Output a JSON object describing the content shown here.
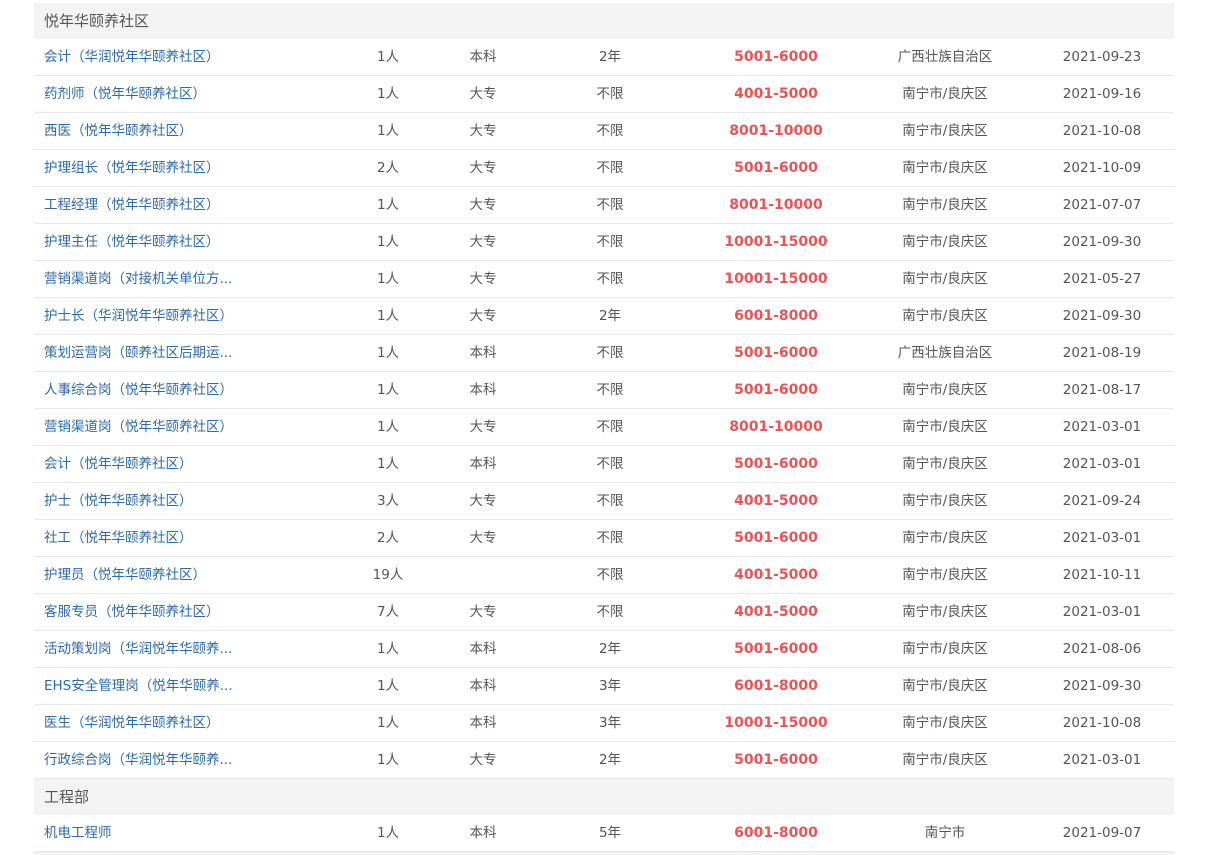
{
  "sections": [
    {
      "title": "悦年华颐养社区",
      "rows": [
        {
          "title": "会计（华润悦年华颐养社区）",
          "num": "1人",
          "edu": "本科",
          "exp": "2年",
          "salary": "5001-6000",
          "location": "广西壮族自治区",
          "date": "2021-09-23"
        },
        {
          "title": "药剂师（悦年华颐养社区）",
          "num": "1人",
          "edu": "大专",
          "exp": "不限",
          "salary": "4001-5000",
          "location": "南宁市/良庆区",
          "date": "2021-09-16"
        },
        {
          "title": "西医（悦年华颐养社区）",
          "num": "1人",
          "edu": "大专",
          "exp": "不限",
          "salary": "8001-10000",
          "location": "南宁市/良庆区",
          "date": "2021-10-08"
        },
        {
          "title": "护理组长（悦年华颐养社区）",
          "num": "2人",
          "edu": "大专",
          "exp": "不限",
          "salary": "5001-6000",
          "location": "南宁市/良庆区",
          "date": "2021-10-09"
        },
        {
          "title": "工程经理（悦年华颐养社区）",
          "num": "1人",
          "edu": "大专",
          "exp": "不限",
          "salary": "8001-10000",
          "location": "南宁市/良庆区",
          "date": "2021-07-07"
        },
        {
          "title": "护理主任（悦年华颐养社区）",
          "num": "1人",
          "edu": "大专",
          "exp": "不限",
          "salary": "10001-15000",
          "location": "南宁市/良庆区",
          "date": "2021-09-30"
        },
        {
          "title": "营销渠道岗（对接机关单位方...",
          "num": "1人",
          "edu": "大专",
          "exp": "不限",
          "salary": "10001-15000",
          "location": "南宁市/良庆区",
          "date": "2021-05-27"
        },
        {
          "title": "护士长（华润悦年华颐养社区）",
          "num": "1人",
          "edu": "大专",
          "exp": "2年",
          "salary": "6001-8000",
          "location": "南宁市/良庆区",
          "date": "2021-09-30"
        },
        {
          "title": "策划运营岗（颐养社区后期运...",
          "num": "1人",
          "edu": "本科",
          "exp": "不限",
          "salary": "5001-6000",
          "location": "广西壮族自治区",
          "date": "2021-08-19"
        },
        {
          "title": "人事综合岗（悦年华颐养社区）",
          "num": "1人",
          "edu": "本科",
          "exp": "不限",
          "salary": "5001-6000",
          "location": "南宁市/良庆区",
          "date": "2021-08-17"
        },
        {
          "title": "营销渠道岗（悦年华颐养社区）",
          "num": "1人",
          "edu": "大专",
          "exp": "不限",
          "salary": "8001-10000",
          "location": "南宁市/良庆区",
          "date": "2021-03-01"
        },
        {
          "title": "会计（悦年华颐养社区）",
          "num": "1人",
          "edu": "本科",
          "exp": "不限",
          "salary": "5001-6000",
          "location": "南宁市/良庆区",
          "date": "2021-03-01"
        },
        {
          "title": "护士（悦年华颐养社区）",
          "num": "3人",
          "edu": "大专",
          "exp": "不限",
          "salary": "4001-5000",
          "location": "南宁市/良庆区",
          "date": "2021-09-24"
        },
        {
          "title": "社工（悦年华颐养社区）",
          "num": "2人",
          "edu": "大专",
          "exp": "不限",
          "salary": "5001-6000",
          "location": "南宁市/良庆区",
          "date": "2021-03-01"
        },
        {
          "title": "护理员（悦年华颐养社区）",
          "num": "19人",
          "edu": "",
          "exp": "不限",
          "salary": "4001-5000",
          "location": "南宁市/良庆区",
          "date": "2021-10-11"
        },
        {
          "title": "客服专员（悦年华颐养社区）",
          "num": "7人",
          "edu": "大专",
          "exp": "不限",
          "salary": "4001-5000",
          "location": "南宁市/良庆区",
          "date": "2021-03-01"
        },
        {
          "title": "活动策划岗（华润悦年华颐养...",
          "num": "1人",
          "edu": "本科",
          "exp": "2年",
          "salary": "5001-6000",
          "location": "南宁市/良庆区",
          "date": "2021-08-06"
        },
        {
          "title": "EHS安全管理岗（悦年华颐养...",
          "num": "1人",
          "edu": "本科",
          "exp": "3年",
          "salary": "6001-8000",
          "location": "南宁市/良庆区",
          "date": "2021-09-30"
        },
        {
          "title": "医生（华润悦年华颐养社区）",
          "num": "1人",
          "edu": "本科",
          "exp": "3年",
          "salary": "10001-15000",
          "location": "南宁市/良庆区",
          "date": "2021-10-08"
        },
        {
          "title": "行政综合岗（华润悦年华颐养...",
          "num": "1人",
          "edu": "大专",
          "exp": "2年",
          "salary": "5001-6000",
          "location": "南宁市/良庆区",
          "date": "2021-03-01"
        }
      ]
    },
    {
      "title": "工程部",
      "rows": [
        {
          "title": "机电工程师",
          "num": "1人",
          "edu": "本科",
          "exp": "5年",
          "salary": "6001-8000",
          "location": "南宁市",
          "date": "2021-09-07"
        }
      ]
    }
  ]
}
